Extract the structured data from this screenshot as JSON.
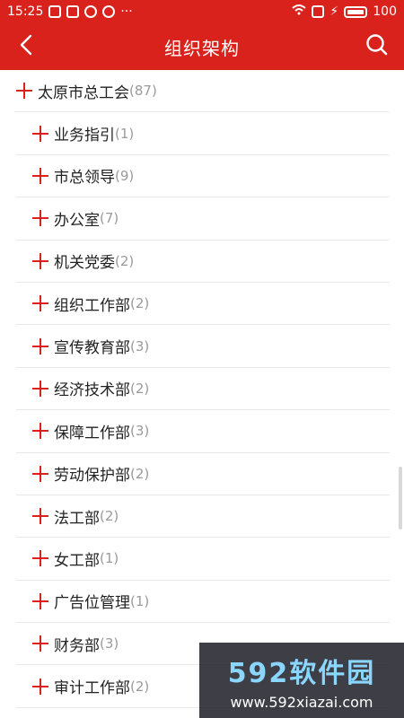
{
  "status_bar": {
    "time": "15:25",
    "more": "···",
    "battery": "100"
  },
  "app_bar": {
    "title": "组织架构",
    "back_icon": "chevron-left-icon",
    "search_icon": "search-icon"
  },
  "tree": {
    "root": {
      "label": "太原市总工会",
      "count": "(87)"
    },
    "children": [
      {
        "label": "业务指引",
        "count": "(1)"
      },
      {
        "label": "市总领导",
        "count": "(9)"
      },
      {
        "label": "办公室",
        "count": "(7)"
      },
      {
        "label": "机关党委",
        "count": "(2)"
      },
      {
        "label": "组织工作部",
        "count": "(2)"
      },
      {
        "label": "宣传教育部",
        "count": "(3)"
      },
      {
        "label": "经济技术部",
        "count": "(2)"
      },
      {
        "label": "保障工作部",
        "count": "(3)"
      },
      {
        "label": "劳动保护部",
        "count": "(2)"
      },
      {
        "label": "法工部",
        "count": "(2)"
      },
      {
        "label": "女工部",
        "count": "(1)"
      },
      {
        "label": "广告位管理",
        "count": "(1)"
      },
      {
        "label": "财务部",
        "count": "(3)"
      },
      {
        "label": "审计工作部",
        "count": "(2)"
      }
    ]
  },
  "watermark": {
    "title": "592软件园",
    "url": "www.592xiazai.com"
  },
  "colors": {
    "accent": "#d9221c",
    "divider": "#e8e8e8",
    "count_text": "#9a9a9a"
  }
}
